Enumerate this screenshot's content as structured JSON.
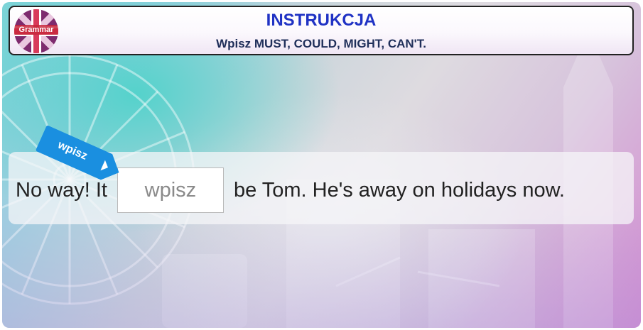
{
  "header": {
    "logo_text": "Grammar",
    "title": "INSTRUKCJA",
    "subtitle": "Wpisz MUST, COULD, MIGHT, CAN'T."
  },
  "tag": {
    "label": "wpisz"
  },
  "exercise": {
    "before": "No way! It",
    "answer_placeholder": "wpisz",
    "after": "be Tom. He's away on holidays now."
  },
  "colors": {
    "title": "#1f32c4",
    "subtitle": "#1f2f5a",
    "tag": "#1a8fe0",
    "logo_red": "#c8283c"
  }
}
